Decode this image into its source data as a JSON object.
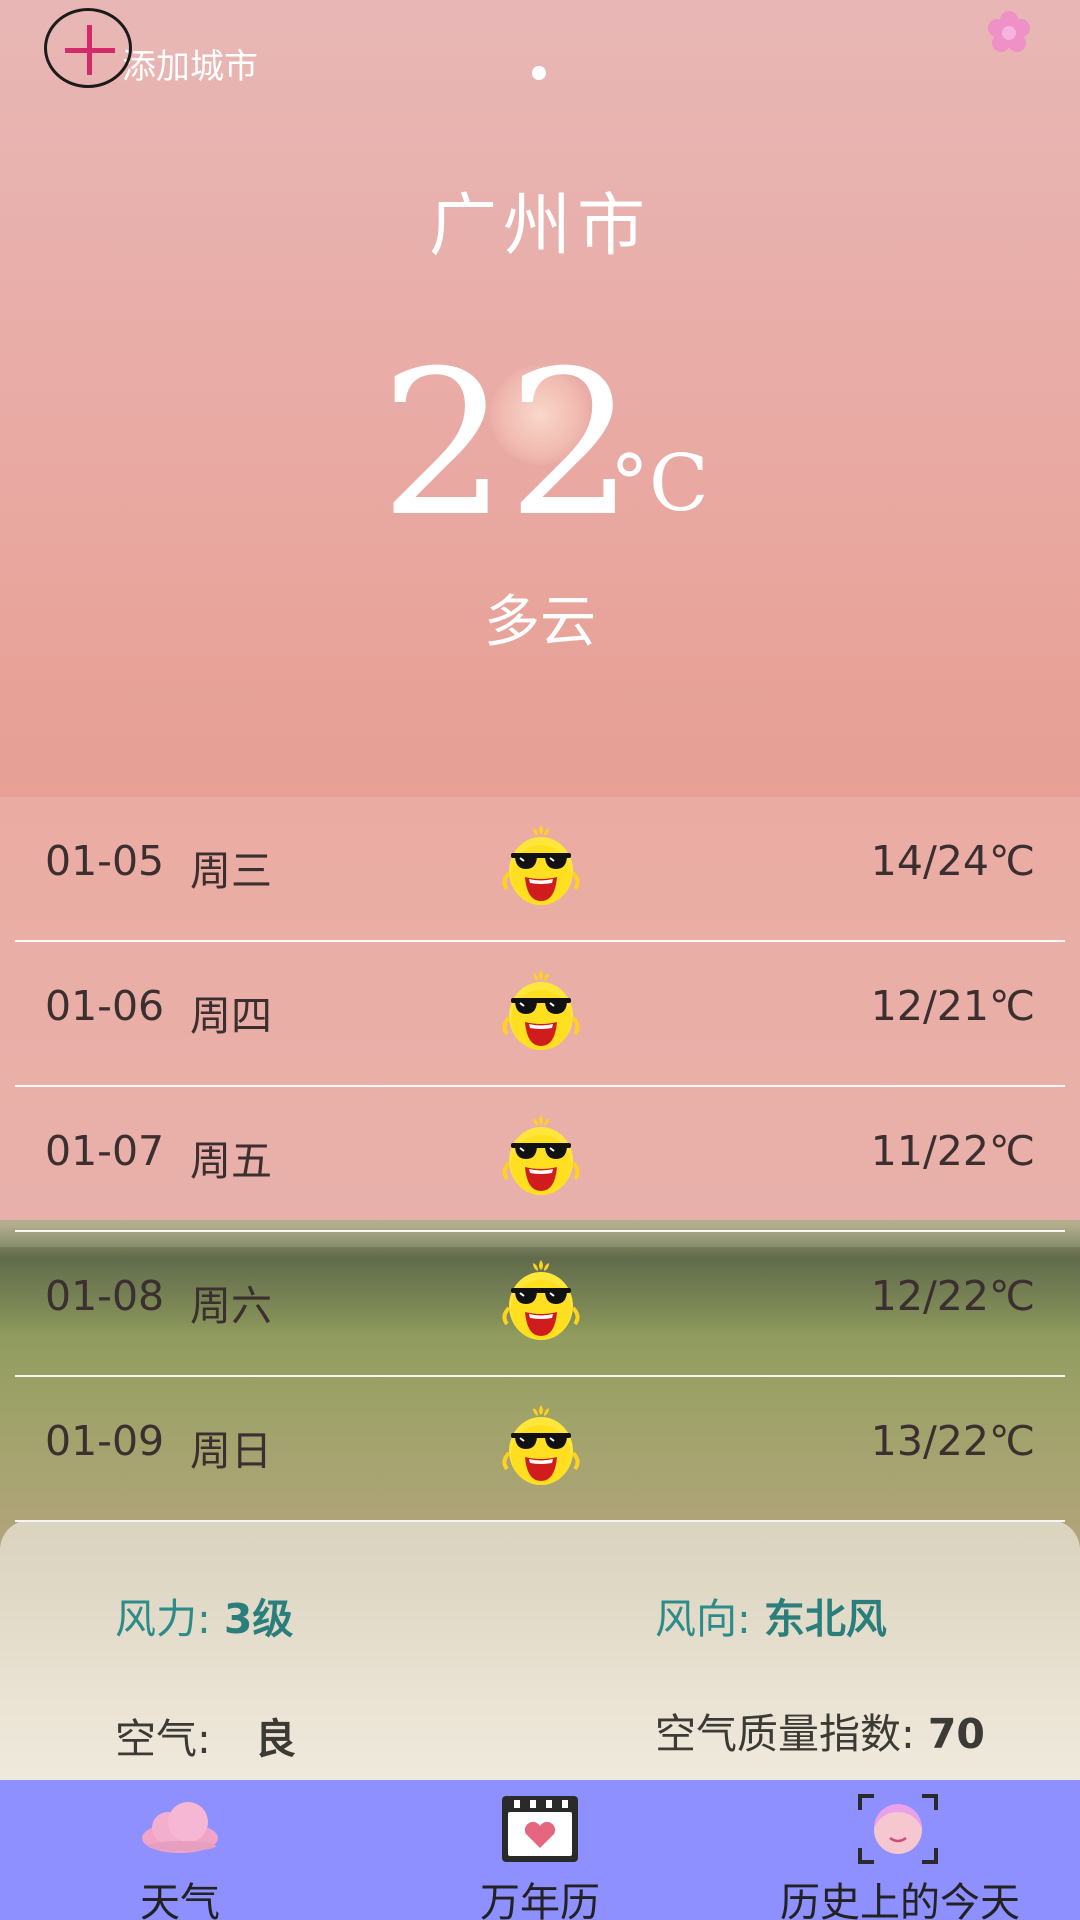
{
  "header": {
    "add_city_label": "添加城市",
    "city": "广州市",
    "temperature": "22",
    "unit": "°C",
    "condition": "多云"
  },
  "forecast": [
    {
      "date": "01-05",
      "weekday": "周三",
      "range": "14/24℃",
      "icon": "sunglasses-sun-icon"
    },
    {
      "date": "01-06",
      "weekday": "周四",
      "range": "12/21℃",
      "icon": "sunglasses-sun-icon"
    },
    {
      "date": "01-07",
      "weekday": "周五",
      "range": "11/22℃",
      "icon": "sunglasses-sun-icon"
    },
    {
      "date": "01-08",
      "weekday": "周六",
      "range": "12/22℃",
      "icon": "sunglasses-sun-icon"
    },
    {
      "date": "01-09",
      "weekday": "周日",
      "range": "13/22℃",
      "icon": "sunglasses-sun-icon"
    }
  ],
  "info": {
    "wind_power_key": "风力: ",
    "wind_power_val": "3级",
    "wind_dir_key": "风向: ",
    "wind_dir_val": "东北风",
    "air_key": "空气:",
    "air_val": "良",
    "aqi_key": "空气质量指数: ",
    "aqi_val": "70"
  },
  "nav": {
    "weather": "天气",
    "calendar": "万年历",
    "history": "历史上的今天"
  },
  "colors": {
    "nav_bg": "#8e90ff",
    "teal_text": "#2d8c8a",
    "plus_accent": "#d42a6a"
  }
}
